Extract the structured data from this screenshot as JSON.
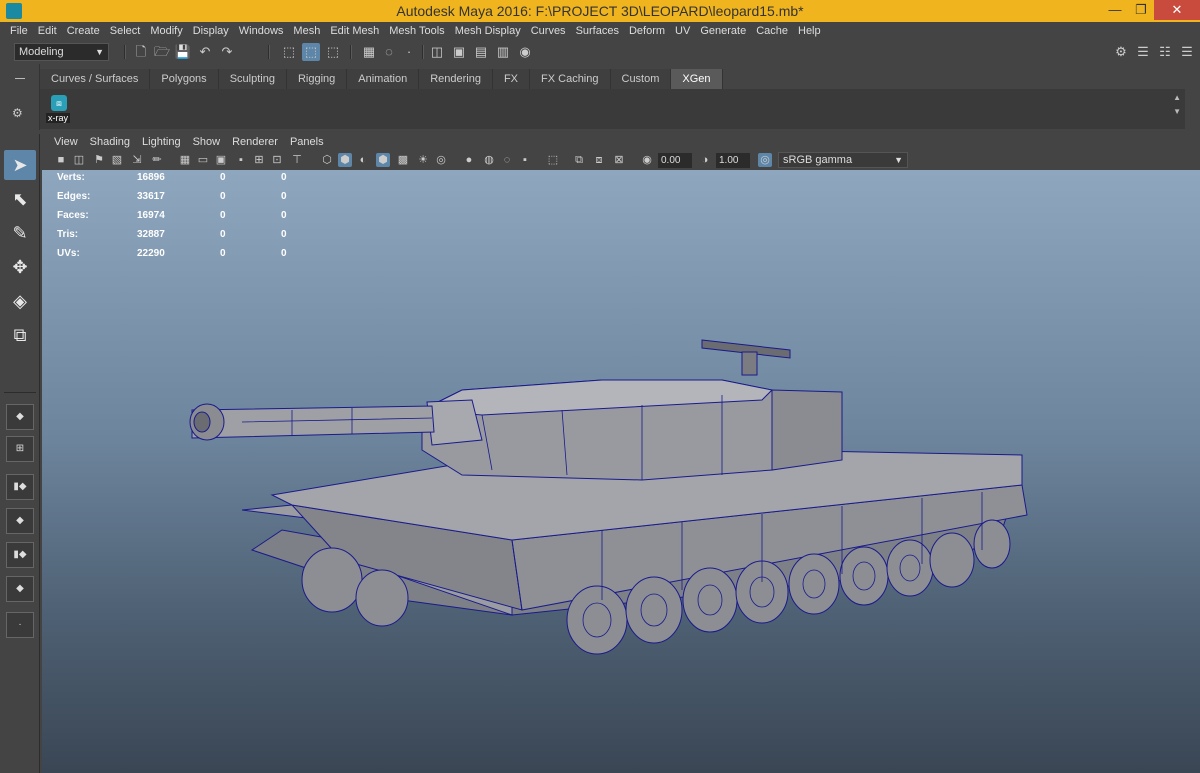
{
  "window": {
    "title": "Autodesk Maya 2016: F:\\PROJECT 3D\\LEOPARD\\leopard15.mb*",
    "min_glyph": "—",
    "max_glyph": "❐",
    "close_glyph": "✕"
  },
  "menu": [
    "File",
    "Edit",
    "Create",
    "Select",
    "Modify",
    "Display",
    "Windows",
    "Mesh",
    "Edit Mesh",
    "Mesh Tools",
    "Mesh Display",
    "Curves",
    "Surfaces",
    "Deform",
    "UV",
    "Generate",
    "Cache",
    "Help"
  ],
  "status": {
    "mode": "Modeling"
  },
  "shelf": {
    "tabs": [
      "Curves / Surfaces",
      "Polygons",
      "Sculpting",
      "Rigging",
      "Animation",
      "Rendering",
      "FX",
      "FX Caching",
      "Custom",
      "XGen"
    ],
    "active_tab": "XGen",
    "xray_label": "x-ray"
  },
  "panel_menu": [
    "View",
    "Shading",
    "Lighting",
    "Show",
    "Renderer",
    "Panels"
  ],
  "panel_toolbar": {
    "exposure": "0.00",
    "gamma_value": "1.00",
    "color_space": "sRGB gamma"
  },
  "hud": [
    {
      "label": "Verts:",
      "v1": "16896",
      "v2": "0",
      "v3": "0"
    },
    {
      "label": "Edges:",
      "v1": "33617",
      "v2": "0",
      "v3": "0"
    },
    {
      "label": "Faces:",
      "v1": "16974",
      "v2": "0",
      "v3": "0"
    },
    {
      "label": "Tris:",
      "v1": "32887",
      "v2": "0",
      "v3": "0"
    },
    {
      "label": "UVs:",
      "v1": "22290",
      "v2": "0",
      "v3": "0"
    }
  ],
  "colors": {
    "title_bar": "#f0b51e",
    "accent": "#5d86a8",
    "wireframe": "#1a1a8c",
    "mesh_fill": "#8c8e94"
  }
}
